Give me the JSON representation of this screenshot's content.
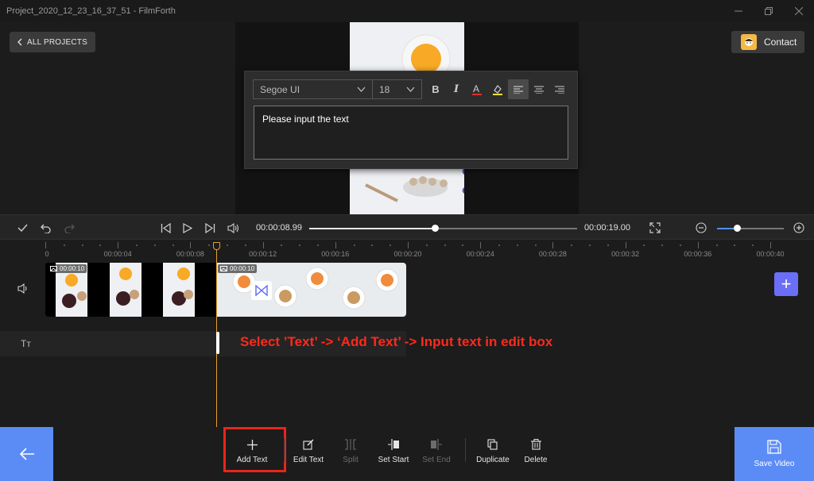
{
  "window": {
    "title": "Project_2020_12_23_16_37_51 - FilmForth",
    "controls": [
      "minimize-icon",
      "restore-icon",
      "close-icon"
    ]
  },
  "header": {
    "all_projects_label": "ALL PROJECTS",
    "contact_label": "Contact"
  },
  "text_editor": {
    "font_family_value": "Segoe UI",
    "font_size_value": "18",
    "format_buttons": [
      "bold-icon",
      "italic-icon",
      "font-color-icon",
      "highlight-icon",
      "align-left-icon",
      "align-center-icon",
      "align-right-icon"
    ],
    "active_alignment": "align-left",
    "input_placeholder": "Please input the text"
  },
  "playback": {
    "current_time": "00:00:08.99",
    "total_time": "00:00:19.00",
    "progress_fraction": 0.47,
    "zoom_fraction": 0.3
  },
  "timeline": {
    "ruler_labels": [
      "0",
      "00:00:04",
      "00:00:08",
      "00:00:12",
      "00:00:16",
      "00:00:20",
      "00:00:24",
      "00:00:28",
      "00:00:32",
      "00:00:36",
      "00:00:40"
    ],
    "clips": [
      {
        "duration": "00:00:10"
      },
      {
        "duration": "00:00:10"
      }
    ],
    "text_track_label": "Tт",
    "annotation": "Select ’Text’ -> ‘Add  Text’ -> Input text in edit box"
  },
  "toolbar": {
    "tools": [
      {
        "label": "Add Text",
        "icon": "plus-icon",
        "enabled": true
      },
      {
        "label": "Edit Text",
        "icon": "pencil-icon",
        "enabled": true
      },
      {
        "label": "Split",
        "icon": "split-icon",
        "enabled": false
      },
      {
        "label": "Set Start",
        "icon": "set-start-icon",
        "enabled": true
      },
      {
        "label": "Set End",
        "icon": "set-end-icon",
        "enabled": false
      },
      {
        "label": "Duplicate",
        "icon": "duplicate-icon",
        "enabled": true
      },
      {
        "label": "Delete",
        "icon": "trash-icon",
        "enabled": true
      }
    ],
    "save_label": "Save Video"
  },
  "colors": {
    "accent": "#5b8cf6",
    "add_track": "#6b6ef6",
    "playhead": "#e6a02e",
    "annotation": "#ff2a1a"
  }
}
